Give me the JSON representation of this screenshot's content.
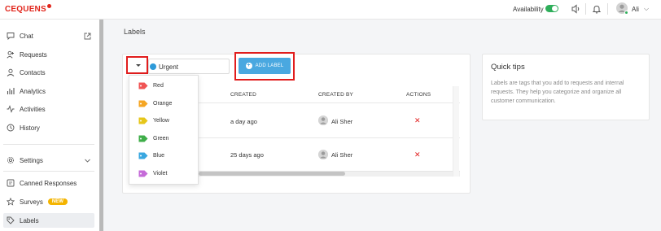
{
  "app": {
    "logo": "CEQUENS"
  },
  "topbar": {
    "availability_label": "Availability",
    "user_name": "Ali",
    "colors": {
      "availability_toggle": "#2eae5a"
    }
  },
  "sidebar": {
    "items": [
      {
        "label": "Chat",
        "icon": "chat-icon",
        "trailing_icon": "external-link-icon"
      },
      {
        "label": "Requests",
        "icon": "requests-icon"
      },
      {
        "label": "Contacts",
        "icon": "contacts-icon"
      },
      {
        "label": "Analytics",
        "icon": "analytics-icon"
      },
      {
        "label": "Activities",
        "icon": "activities-icon"
      },
      {
        "label": "History",
        "icon": "history-icon"
      },
      {
        "label": "Settings",
        "icon": "gear-icon",
        "trailing_icon": "chevron-down-icon"
      },
      {
        "label": "Canned Responses",
        "icon": "canned-responses-icon"
      },
      {
        "label": "Surveys",
        "icon": "star-icon",
        "badge": "NEW"
      },
      {
        "label": "Labels",
        "icon": "tag-icon",
        "active": true
      }
    ]
  },
  "main": {
    "page_title": "Labels",
    "filter": {
      "selected": "Urgent",
      "selected_color": "#2e9ad9"
    },
    "add_label_button": "ADD LABEL",
    "dropdown": [
      {
        "label": "Red",
        "color": "#f05454"
      },
      {
        "label": "Orange",
        "color": "#f5a623"
      },
      {
        "label": "Yellow",
        "color": "#e6c619"
      },
      {
        "label": "Green",
        "color": "#3fae49"
      },
      {
        "label": "Blue",
        "color": "#39a7e0"
      },
      {
        "label": "Violet",
        "color": "#c56bd8"
      }
    ],
    "table": {
      "headers": [
        "CREATED",
        "CREATED BY",
        "ACTIONS"
      ],
      "rows": [
        {
          "created": "a day ago",
          "created_by": "Ali Sher"
        },
        {
          "created": "25 days ago",
          "created_by": "Ali Sher"
        }
      ],
      "delete_symbol": "✕"
    }
  },
  "tips": {
    "title": "Quick tips",
    "text": "Labels are tags that you add to requests and internal requests. They help you categorize and organize all customer communication."
  }
}
